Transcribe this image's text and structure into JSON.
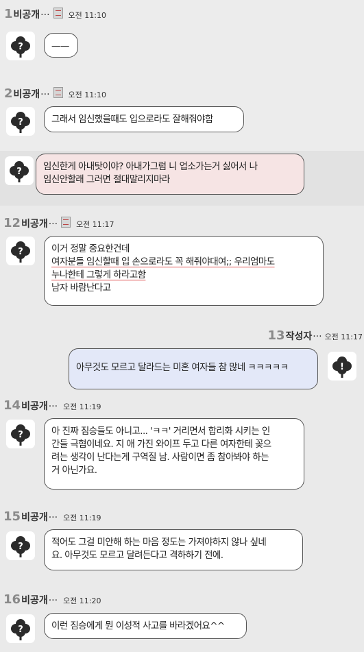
{
  "messages": [
    {
      "num": "1",
      "name": "비공개",
      "dots": "···",
      "time": "오전 11:10",
      "lines": [
        "——"
      ]
    },
    {
      "num": "2",
      "name": "비공개",
      "dots": "···",
      "time": "오전 11:10",
      "lines": [
        "그래서 임신했을때도 입으로라도 잘해줘야함"
      ]
    },
    {
      "lines": [
        "임신한게 아내탓이야? 아내가그럼 니 업소가는거 싫어서 나",
        "임신안할래 그러면 절대말리지마라"
      ]
    },
    {
      "num": "12",
      "name": "비공개",
      "dots": "···",
      "time": "오전 11:17",
      "lines": [
        "이거 정말 중요한건데",
        "여자분들 임신할때 입 손으로라도 꼭 해줘야대여;; 우리엄마도",
        "누나한테 그렇게 하라고함",
        "남자 바람난다고"
      ]
    },
    {
      "num": "13",
      "name": "작성자",
      "dots": "···",
      "time": "오전 11:17",
      "lines": [
        "아무것도 모르고 달라드는 미혼 여자들 참 많네 ㅋㅋㅋㅋㅋ"
      ]
    },
    {
      "num": "14",
      "name": "비공개",
      "dots": "···",
      "time": "오전 11:19",
      "lines": [
        "아 진짜 짐승들도 아니고... 'ㅋㅋ' 거리면서 합리화 시키는 인",
        "간들 극혐이네요. 지 애 가진 와이프 두고 다른 여자한테 꽂으",
        "려는 생각이 난다는게 구역질 남. 사람이면 좀 참아봐야 하는",
        "거 아닌가요."
      ]
    },
    {
      "num": "15",
      "name": "비공개",
      "dots": "···",
      "time": "오전 11:19",
      "lines": [
        "적어도 그걸 미안해 하는 마음 정도는 가져야하지 않나 싶네",
        "요. 아무것도 모르고 달려든다고 격하하기 전에."
      ]
    },
    {
      "num": "16",
      "name": "비공개",
      "dots": "···",
      "time": "오전 11:20",
      "lines": [
        "이런 짐승에게 뭔 이성적 사고를 바라겠어요^^"
      ]
    }
  ],
  "colors": {
    "pink_bubble": "#f6e4e4",
    "blue_bubble": "#e3e8f8",
    "band_light": "#f1f1f1",
    "band_dark": "#e6e6e6"
  }
}
